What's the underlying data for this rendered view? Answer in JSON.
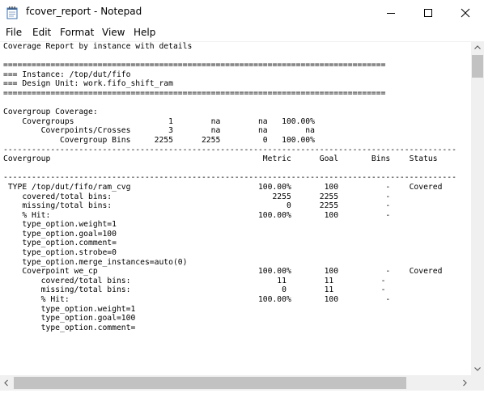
{
  "window": {
    "title": "fcover_report - Notepad"
  },
  "menu": {
    "items": [
      "File",
      "Edit",
      "Format",
      "View",
      "Help"
    ]
  },
  "icons": {
    "app": "notepad-icon",
    "minimize": "minimize-icon",
    "maximize": "maximize-icon",
    "close": "close-icon"
  },
  "editor": {
    "lines": [
      "Coverage Report by instance with details",
      "",
      "=================================================================================",
      "=== Instance: /top/dut/fifo",
      "=== Design Unit: work.fifo_shift_ram",
      "=================================================================================",
      "",
      "Covergroup Coverage:",
      "    Covergroups                    1        na        na   100.00%",
      "        Coverpoints/Crosses        3        na        na        na",
      "            Covergroup Bins     2255      2255         0   100.00%",
      "------------------------------------------------------------------------------------------------",
      "Covergroup                                             Metric      Goal       Bins    Status",
      "",
      "------------------------------------------------------------------------------------------------",
      " TYPE /top/dut/fifo/ram_cvg                           100.00%       100          -    Covered",
      "    covered/total bins:                                  2255      2255          -",
      "    missing/total bins:                                     0      2255          -",
      "    % Hit:                                            100.00%       100          -",
      "    type_option.weight=1",
      "    type_option.goal=100",
      "    type_option.comment=",
      "    type_option.strobe=0",
      "    type_option.merge_instances=auto(0)",
      "    Coverpoint we_cp                                  100.00%       100          -    Covered",
      "        covered/total bins:                               11        11          -",
      "        missing/total bins:                                0        11          -",
      "        % Hit:                                        100.00%       100          -",
      "        type_option.weight=1",
      "        type_option.goal=100",
      "        type_option.comment="
    ]
  }
}
